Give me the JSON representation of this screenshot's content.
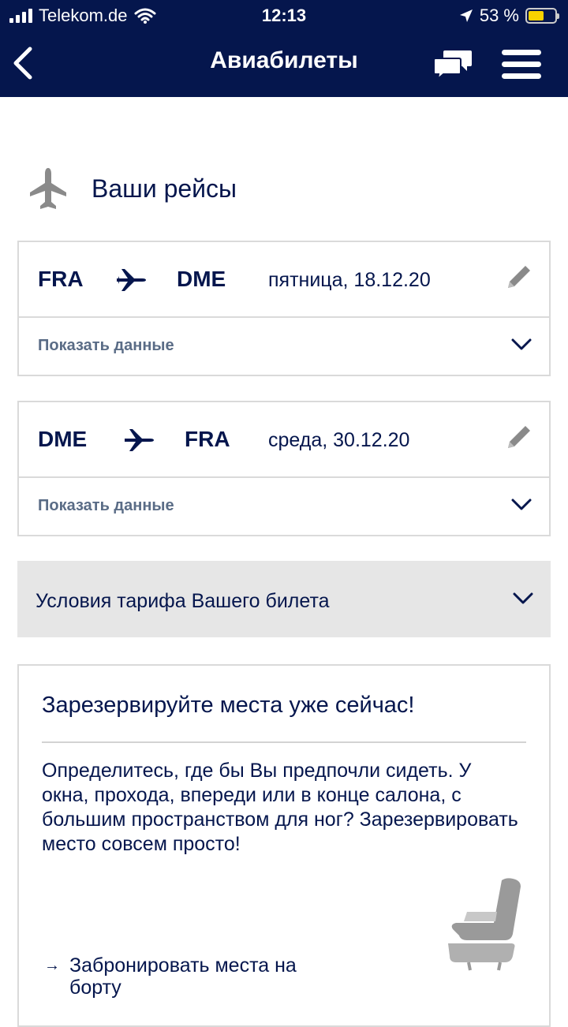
{
  "status_bar": {
    "carrier": "Telekom.de",
    "time": "12:13",
    "battery": "53 %"
  },
  "header": {
    "title": "Авиабилеты"
  },
  "section": {
    "title": "Ваши рейсы"
  },
  "flights": [
    {
      "from": "FRA",
      "to": "DME",
      "date": "пятница, 18.12.20",
      "show_label": "Показать данные"
    },
    {
      "from": "DME",
      "to": "FRA",
      "date": "среда, 30.12.20",
      "show_label": "Показать данные"
    }
  ],
  "tariff": {
    "label": "Условия тарифа Вашего билета"
  },
  "seat_promo": {
    "title": "Зарезервируйте места уже сейчас!",
    "description": "Определитесь, где бы Вы предпочли сидеть. У окна, прохода, впереди или в конце салона, с большим пространством для ног? Зарезервировать место совсем просто!",
    "link_arrow": "→",
    "link_label": "Забронировать места на борту"
  },
  "colors": {
    "brand": "#05164d",
    "muted": "#5a6c86",
    "panel": "#e6e6e6",
    "battery": "#f8d200"
  }
}
